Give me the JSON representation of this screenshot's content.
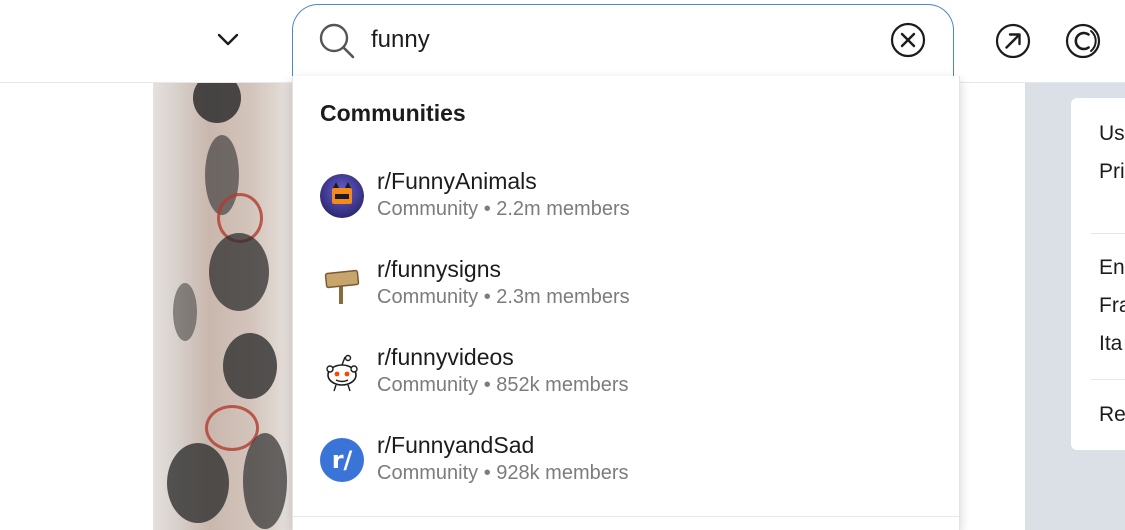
{
  "search": {
    "value": "funny"
  },
  "dropdown": {
    "heading": "Communities",
    "items": [
      {
        "name": "r/FunnyAnimals",
        "meta": "Community • 2.2m members",
        "icon": "funnyanimals-avatar"
      },
      {
        "name": "r/funnysigns",
        "meta": "Community • 2.3m members",
        "icon": "signpost-icon"
      },
      {
        "name": "r/funnyvideos",
        "meta": "Community • 852k members",
        "icon": "reddit-snoo-icon"
      },
      {
        "name": "r/FunnyandSad",
        "meta": "Community • 928k members",
        "icon": "r-slash-icon",
        "avatar_text": "r/"
      }
    ]
  },
  "sidebar_card": {
    "lines_top": [
      "Us",
      "Pri"
    ],
    "lines_lang": [
      "En",
      "Fra",
      "Ita"
    ],
    "line_bottom": "Rec"
  },
  "colors": {
    "accent_blue": "#4a86d4",
    "rslash_blue": "#3b74d8",
    "panel_bg": "#dae0e6"
  }
}
